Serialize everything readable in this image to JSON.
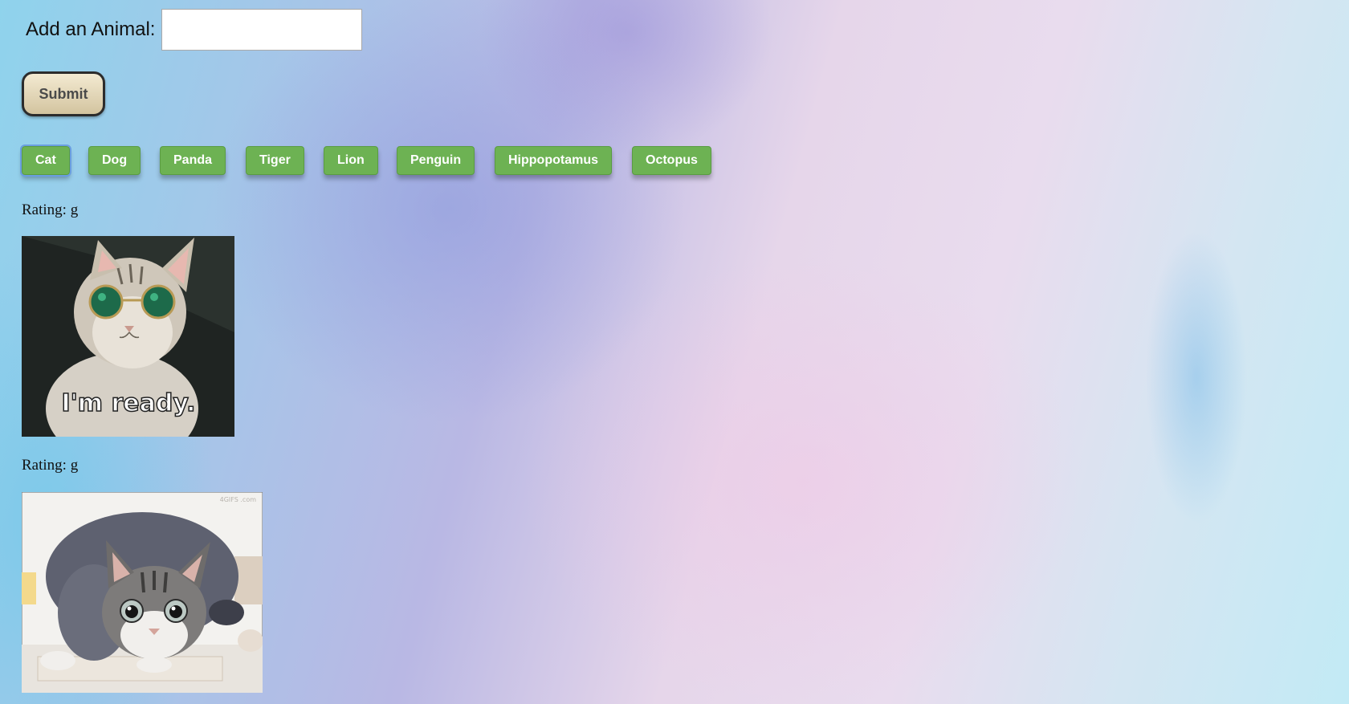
{
  "form": {
    "label": "Add an Animal:",
    "input_value": "",
    "input_placeholder": ""
  },
  "submit_label": "Submit",
  "animal_buttons": [
    "Cat",
    "Dog",
    "Panda",
    "Tiger",
    "Lion",
    "Penguin",
    "Hippopotamus",
    "Octopus"
  ],
  "results": [
    {
      "rating": "Rating: g",
      "caption": "I'm ready."
    },
    {
      "rating": "Rating: g",
      "watermark": "4GIFS .com"
    }
  ],
  "colors": {
    "animal_button": "#6db253",
    "submit_button": "#e2d5b3"
  }
}
